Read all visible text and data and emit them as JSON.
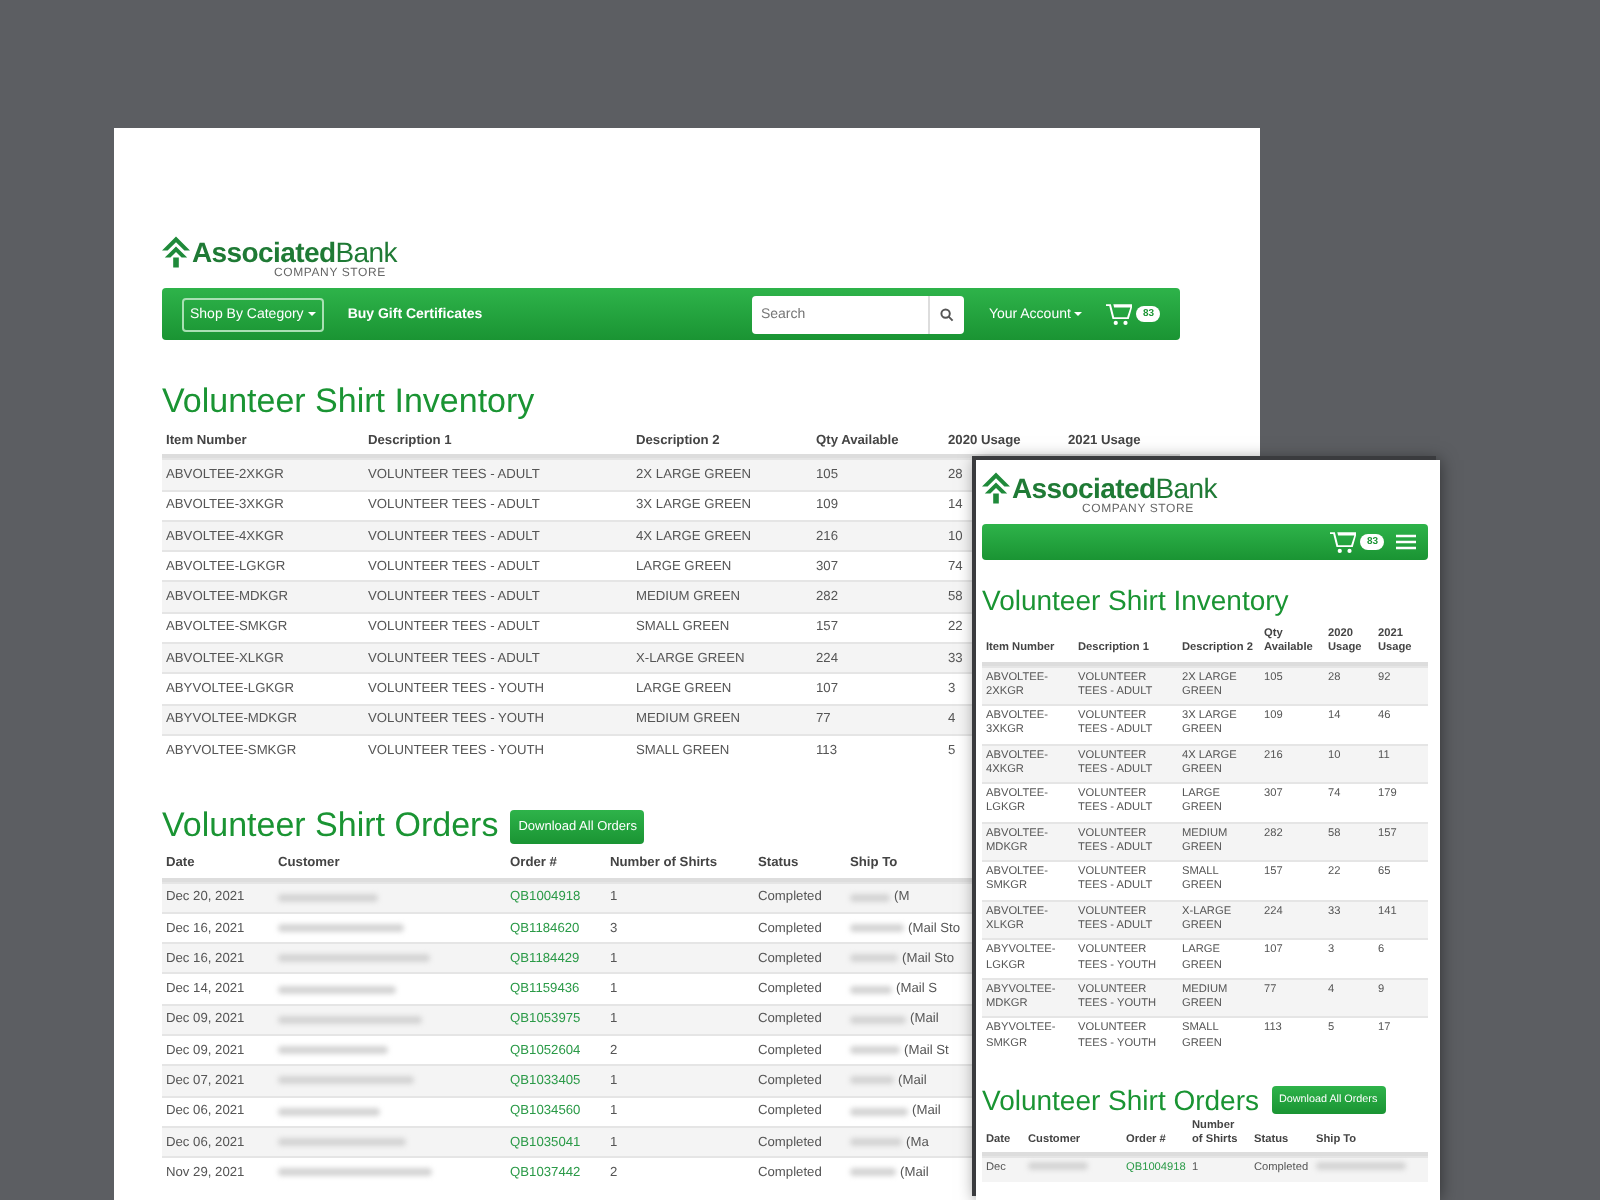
{
  "desktop": {
    "logo": {
      "name_bold": "Associated",
      "name_rest": "Bank",
      "tagline": "COMPANY STORE"
    },
    "nav": {
      "category_button": "Shop By Category",
      "gift_link": "Buy Gift Certificates",
      "search": {
        "placeholder": "Search"
      },
      "account": "Your Account",
      "cart_count": "83"
    },
    "inventory": {
      "title": "Volunteer Shirt Inventory",
      "columns": [
        "Item Number",
        "Description 1",
        "Description 2",
        "Qty Available",
        "2020 Usage",
        "2021 Usage"
      ],
      "rows": [
        [
          "ABVOLTEE-2XKGR",
          "VOLUNTEER TEES - ADULT",
          "2X LARGE GREEN",
          "105",
          "28"
        ],
        [
          "ABVOLTEE-3XKGR",
          "VOLUNTEER TEES - ADULT",
          "3X LARGE GREEN",
          "109",
          "14"
        ],
        [
          "ABVOLTEE-4XKGR",
          "VOLUNTEER TEES - ADULT",
          "4X LARGE GREEN",
          "216",
          "10"
        ],
        [
          "ABVOLTEE-LGKGR",
          "VOLUNTEER TEES - ADULT",
          "LARGE GREEN",
          "307",
          "74"
        ],
        [
          "ABVOLTEE-MDKGR",
          "VOLUNTEER TEES - ADULT",
          "MEDIUM GREEN",
          "282",
          "58"
        ],
        [
          "ABVOLTEE-SMKGR",
          "VOLUNTEER TEES - ADULT",
          "SMALL GREEN",
          "157",
          "22"
        ],
        [
          "ABVOLTEE-XLKGR",
          "VOLUNTEER TEES - ADULT",
          "X-LARGE GREEN",
          "224",
          "33"
        ],
        [
          "ABYVOLTEE-LGKGR",
          "VOLUNTEER TEES - YOUTH",
          "LARGE GREEN",
          "107",
          "3"
        ],
        [
          "ABYVOLTEE-MDKGR",
          "VOLUNTEER TEES - YOUTH",
          "MEDIUM GREEN",
          "77",
          "4"
        ],
        [
          "ABYVOLTEE-SMKGR",
          "VOLUNTEER TEES - YOUTH",
          "SMALL GREEN",
          "113",
          "5"
        ]
      ]
    },
    "orders": {
      "title": "Volunteer Shirt Orders",
      "download_button": "Download All Orders",
      "columns": [
        "Date",
        "Customer",
        "Order #",
        "Number of Shirts",
        "Status",
        "Ship To"
      ],
      "rows": [
        {
          "date": "Dec 20, 2021",
          "order": "QB1004918",
          "shirts": "1",
          "status": "Completed",
          "ship_to": "(M"
        },
        {
          "date": "Dec 16, 2021",
          "order": "QB1184620",
          "shirts": "3",
          "status": "Completed",
          "ship_to": "(Mail Sto"
        },
        {
          "date": "Dec 16, 2021",
          "order": "QB1184429",
          "shirts": "1",
          "status": "Completed",
          "ship_to": "(Mail Sto"
        },
        {
          "date": "Dec 14, 2021",
          "order": "QB1159436",
          "shirts": "1",
          "status": "Completed",
          "ship_to": "(Mail S"
        },
        {
          "date": "Dec 09, 2021",
          "order": "QB1053975",
          "shirts": "1",
          "status": "Completed",
          "ship_to": "(Mail"
        },
        {
          "date": "Dec 09, 2021",
          "order": "QB1052604",
          "shirts": "2",
          "status": "Completed",
          "ship_to": "(Mail St"
        },
        {
          "date": "Dec 07, 2021",
          "order": "QB1033405",
          "shirts": "1",
          "status": "Completed",
          "ship_to": "(Mail"
        },
        {
          "date": "Dec 06, 2021",
          "order": "QB1034560",
          "shirts": "1",
          "status": "Completed",
          "ship_to": "(Mail"
        },
        {
          "date": "Dec 06, 2021",
          "order": "QB1035041",
          "shirts": "1",
          "status": "Completed",
          "ship_to": "(Ma"
        },
        {
          "date": "Nov 29, 2021",
          "order": "QB1037442",
          "shirts": "2",
          "status": "Completed",
          "ship_to": "(Mail"
        }
      ]
    }
  },
  "mobile": {
    "logo": {
      "name_bold": "Associated",
      "name_rest": "Bank",
      "tagline": "COMPANY STORE"
    },
    "nav": {
      "cart_count": "83"
    },
    "inventory": {
      "title": "Volunteer Shirt Inventory",
      "columns": [
        "Item Number",
        "Description 1",
        "Description 2",
        "Qty Available",
        "2020 Usage",
        "2021 Usage"
      ],
      "rows": [
        [
          "ABVOLTEE-2XKGR",
          "VOLUNTEER TEES - ADULT",
          "2X LARGE GREEN",
          "105",
          "28",
          "92"
        ],
        [
          "ABVOLTEE-3XKGR",
          "VOLUNTEER TEES - ADULT",
          "3X LARGE GREEN",
          "109",
          "14",
          "46"
        ],
        [
          "ABVOLTEE-4XKGR",
          "VOLUNTEER TEES - ADULT",
          "4X LARGE GREEN",
          "216",
          "10",
          "11"
        ],
        [
          "ABVOLTEE-LGKGR",
          "VOLUNTEER TEES - ADULT",
          "LARGE GREEN",
          "307",
          "74",
          "179"
        ],
        [
          "ABVOLTEE-MDKGR",
          "VOLUNTEER TEES - ADULT",
          "MEDIUM GREEN",
          "282",
          "58",
          "157"
        ],
        [
          "ABVOLTEE-SMKGR",
          "VOLUNTEER TEES - ADULT",
          "SMALL GREEN",
          "157",
          "22",
          "65"
        ],
        [
          "ABVOLTEE-XLKGR",
          "VOLUNTEER TEES - ADULT",
          "X-LARGE GREEN",
          "224",
          "33",
          "141"
        ],
        [
          "ABYVOLTEE-LGKGR",
          "VOLUNTEER TEES - YOUTH",
          "LARGE GREEN",
          "107",
          "3",
          "6"
        ],
        [
          "ABYVOLTEE-MDKGR",
          "VOLUNTEER TEES - YOUTH",
          "MEDIUM GREEN",
          "77",
          "4",
          "9"
        ],
        [
          "ABYVOLTEE-SMKGR",
          "VOLUNTEER TEES - YOUTH",
          "SMALL GREEN",
          "113",
          "5",
          "17"
        ]
      ]
    },
    "orders": {
      "title": "Volunteer Shirt Orders",
      "download_button": "Download All Orders",
      "columns": [
        "Date",
        "Customer",
        "Order #",
        "Number of Shirts",
        "Status",
        "Ship To"
      ],
      "rows": [
        {
          "date": "Dec",
          "order": "QB1004918",
          "shirts": "1",
          "status": "Completed"
        }
      ]
    }
  }
}
